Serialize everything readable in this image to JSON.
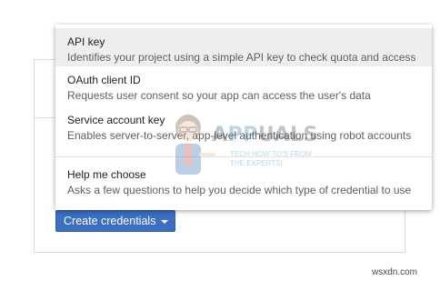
{
  "button": {
    "label": "Create credentials",
    "color": "#3b6ec4"
  },
  "menu": {
    "items": [
      {
        "title": "API key",
        "description": "Identifies your project using a simple API key to check quota and access"
      },
      {
        "title": "OAuth client ID",
        "description": "Requests user consent so your app can access the user's data"
      },
      {
        "title": "Service account key",
        "description": "Enables server-to-server, app-level authentication using robot accounts"
      },
      {
        "title": "Help me choose",
        "description": "Asks a few questions to help you decide which type of credential to use"
      }
    ]
  },
  "watermark": {
    "brand": "APPUALS",
    "tagline_line1": "TECH HOW-TO'S FROM",
    "tagline_line2": "THE EXPERTS!"
  },
  "site": "wsxdn.com",
  "colors": {
    "highlight": "#eeeeee",
    "text_primary": "#222222",
    "text_secondary": "#5f5f5f",
    "divider": "#dadada"
  }
}
